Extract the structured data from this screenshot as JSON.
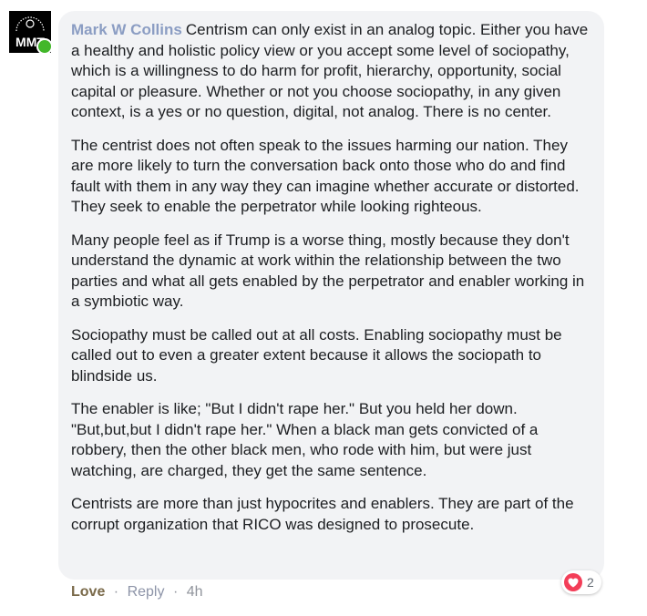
{
  "comment": {
    "author": "Mark W Collins",
    "avatar_icon": "mmt-logo-icon",
    "avatar_text": "MMT",
    "online": true,
    "paragraphs": [
      "Centrism can only exist in an analog topic. Either you have a healthy and holistic policy view or you accept some level of sociopathy, which is a willingness to do harm for profit, hierarchy, opportunity, social capital or pleasure. Whether or not you choose sociopathy, in any given context, is a yes or no question, digital, not analog. There is no center.",
      "The centrist does not often speak to the issues harming our nation. They are more likely to turn the conversation back onto those who do and find fault with them in any way they can imagine whether accurate or distorted. They seek to enable the perpetrator while looking righteous.",
      "Many people feel as if Trump is a worse thing, mostly because they don't understand the dynamic at work within the relationship between the two parties and what all gets enabled by the perpetrator and enabler working in a symbiotic way.",
      "Sociopathy must be called out at all costs. Enabling sociopathy must be called out to even a greater extent because it allows the sociopath to blindside us.",
      "The enabler is like; \"But I didn't rape her.\" But you held her down. \"But,but,but I didn't rape her.\" When a black man gets convicted of a robbery, then the other black men, who rode with him, but were just watching, are charged, they get the same sentence.",
      "Centrists are more than just hypocrites and enablers. They are part of the corrupt organization that RICO was designed to prosecute."
    ],
    "reactions": {
      "icon": "heart-icon",
      "count": "2"
    }
  },
  "actions": {
    "love": "Love",
    "separator": "·",
    "reply": "Reply",
    "time": "4h"
  },
  "colors": {
    "author": "#8b9dc3",
    "bubble": "#f2f3f5",
    "love": "#7a6a4a",
    "heart": "#f33e58",
    "online": "#42b72a"
  }
}
